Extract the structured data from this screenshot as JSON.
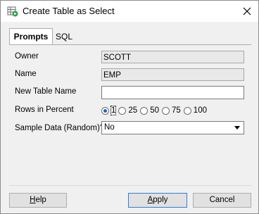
{
  "window": {
    "title": "Create Table as Select"
  },
  "tabs": [
    {
      "label": "Prompts",
      "active": true
    },
    {
      "label": "SQL",
      "active": false
    }
  ],
  "form": {
    "owner": {
      "label": "Owner",
      "value": "SCOTT"
    },
    "name": {
      "label": "Name",
      "value": "EMP"
    },
    "new_table_name": {
      "label": "New Table Name",
      "value": ""
    },
    "rows_in_percent": {
      "label": "Rows in Percent",
      "options": [
        "1",
        "25",
        "50",
        "75",
        "100"
      ],
      "selected": "1"
    },
    "sample_data": {
      "label": "Sample Data (Random)?",
      "value": "No"
    }
  },
  "buttons": {
    "help": {
      "mnemonic": "H",
      "rest": "elp"
    },
    "apply": {
      "mnemonic": "A",
      "rest": "pply"
    },
    "cancel": "Cancel"
  },
  "colors": {
    "accent": "#1a64c8",
    "default_border": "#2f7dd6"
  },
  "icons": {
    "app": "table-select-icon",
    "close": "close-icon"
  }
}
